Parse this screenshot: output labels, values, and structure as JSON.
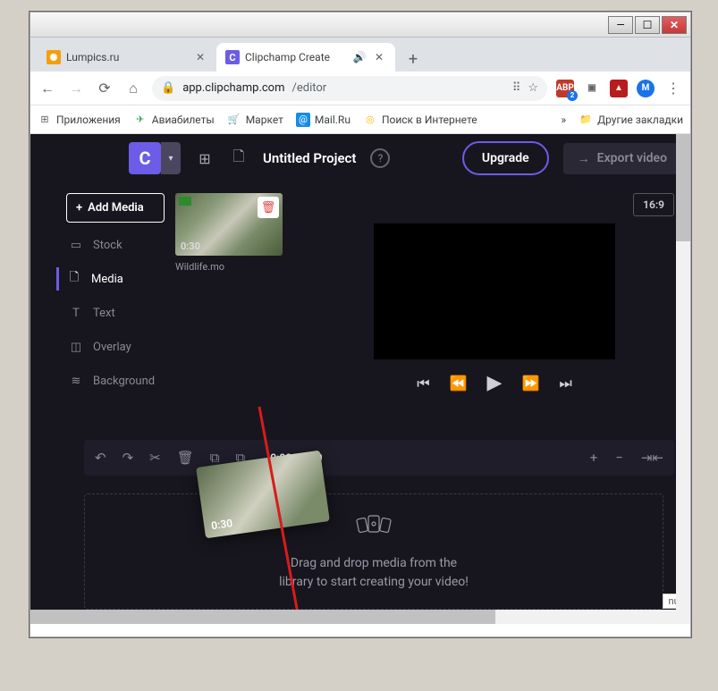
{
  "window": {
    "min": "—",
    "max": "☐",
    "close": "✕"
  },
  "tabs": [
    {
      "title": "Lumpics.ru",
      "favicon_bg": "#f59e0b",
      "favicon_text": "✺",
      "active": false
    },
    {
      "title": "Clipchamp Create",
      "favicon_bg": "#6c5ce7",
      "favicon_text": "C",
      "active": true,
      "audio": true
    }
  ],
  "address": {
    "url_host": "app.clipchamp.com",
    "url_path": "/editor",
    "lock": "🔒",
    "translate": "⠿",
    "star": "☆"
  },
  "extensions": {
    "abp": "ABP",
    "abp_badge": "2",
    "box": "▣",
    "pdf": "▲",
    "avatar": "M",
    "menu": "⋮"
  },
  "bookmarks": {
    "apps": "Приложения",
    "avia": "Авиабилеты",
    "market": "Маркет",
    "mail": "Mail.Ru",
    "search": "Поиск в Интернете",
    "more": "»",
    "other": "Другие закладки"
  },
  "app": {
    "logo": "C",
    "project_title": "Untitled Project",
    "upgrade": "Upgrade",
    "export": "Export video"
  },
  "sidebar": {
    "add_media": "Add Media",
    "items": [
      {
        "icon": "▭",
        "label": "Stock"
      },
      {
        "icon": "🗋",
        "label": "Media"
      },
      {
        "icon": "T",
        "label": "Text"
      },
      {
        "icon": "◫",
        "label": "Overlay"
      },
      {
        "icon": "≋",
        "label": "Background"
      }
    ]
  },
  "media": {
    "duration": "0:30",
    "filename": "Wildlife.mo",
    "drag_duration": "0:30"
  },
  "preview": {
    "ratio": "16:9"
  },
  "timeline": {
    "time": "0:00 / 0:00"
  },
  "dropzone": {
    "line1": "Drag and drop media from the",
    "line2": "library to start creating your video!"
  },
  "null_label": "null"
}
